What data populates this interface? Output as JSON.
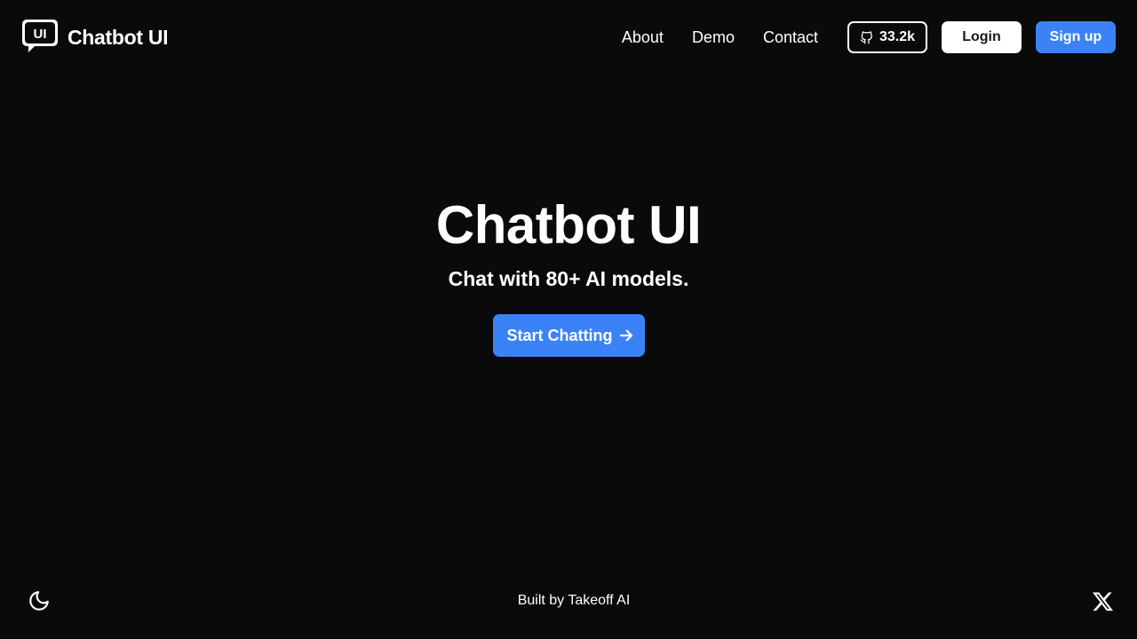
{
  "header": {
    "brand": {
      "logo_text": "UI",
      "name": "Chatbot UI"
    },
    "nav": [
      {
        "label": "About"
      },
      {
        "label": "Demo"
      },
      {
        "label": "Contact"
      }
    ],
    "github": {
      "icon": "github-icon",
      "stars": "33.2k"
    },
    "login_label": "Login",
    "signup_label": "Sign up"
  },
  "hero": {
    "title": "Chatbot UI",
    "subtitle": "Chat with 80+ AI models.",
    "cta_label": "Start Chatting",
    "cta_icon": "arrow-right-icon"
  },
  "footer": {
    "theme_icon": "moon-icon",
    "credit": "Built by Takeoff AI",
    "social_icon": "x-icon"
  },
  "colors": {
    "background": "#0a0a0a",
    "text": "#ffffff",
    "accent": "#3b82f6"
  }
}
